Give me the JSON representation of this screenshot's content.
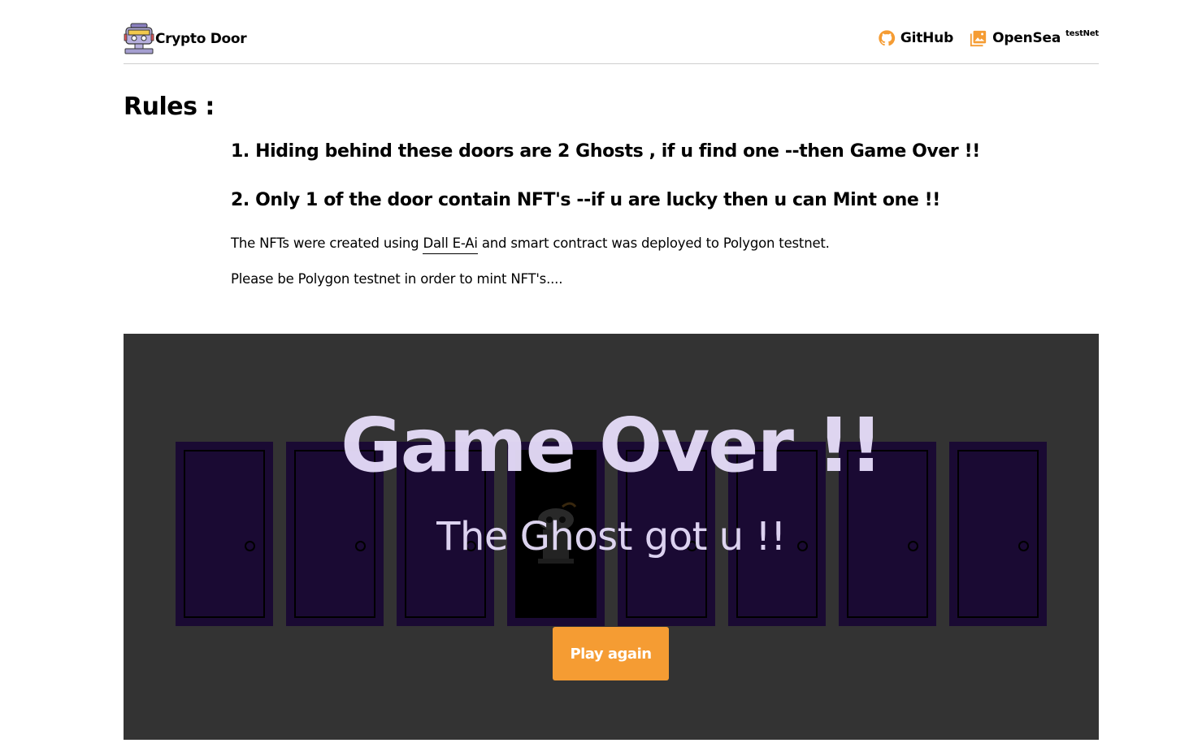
{
  "header": {
    "brand_name": "Crypto Door",
    "brand_logo_icon": "robot-logo-icon",
    "nav": [
      {
        "label": "GitHub",
        "icon": "github-icon"
      },
      {
        "label": "OpenSea",
        "icon": "image-gallery-icon",
        "superscript": "testNet"
      }
    ]
  },
  "rules": {
    "title": "Rules :",
    "items": [
      "1. Hiding behind these doors are 2 Ghosts , if u find one --then Game Over !!",
      "2. Only 1 of the door contain NFT's --if u are lucky then u can Mint one !!"
    ],
    "para1_prefix": "The NFTs were created using ",
    "para1_link": "Dall E-Ai",
    "para1_suffix": " and smart contract was deployed to Polygon testnet.",
    "para2": "Please be Polygon testnet in order to mint NFT's...."
  },
  "game": {
    "title": "Game Over !!",
    "subtitle": "The Ghost got u !!",
    "play_again_label": "Play again",
    "door_count": 8,
    "open_door_index": 3,
    "open_door_content_icon": "ghost-icon",
    "colors": {
      "background": "#333333",
      "door": "#1a0a33",
      "overlay_text": "#ece2ff",
      "button": "#f59c33"
    }
  }
}
